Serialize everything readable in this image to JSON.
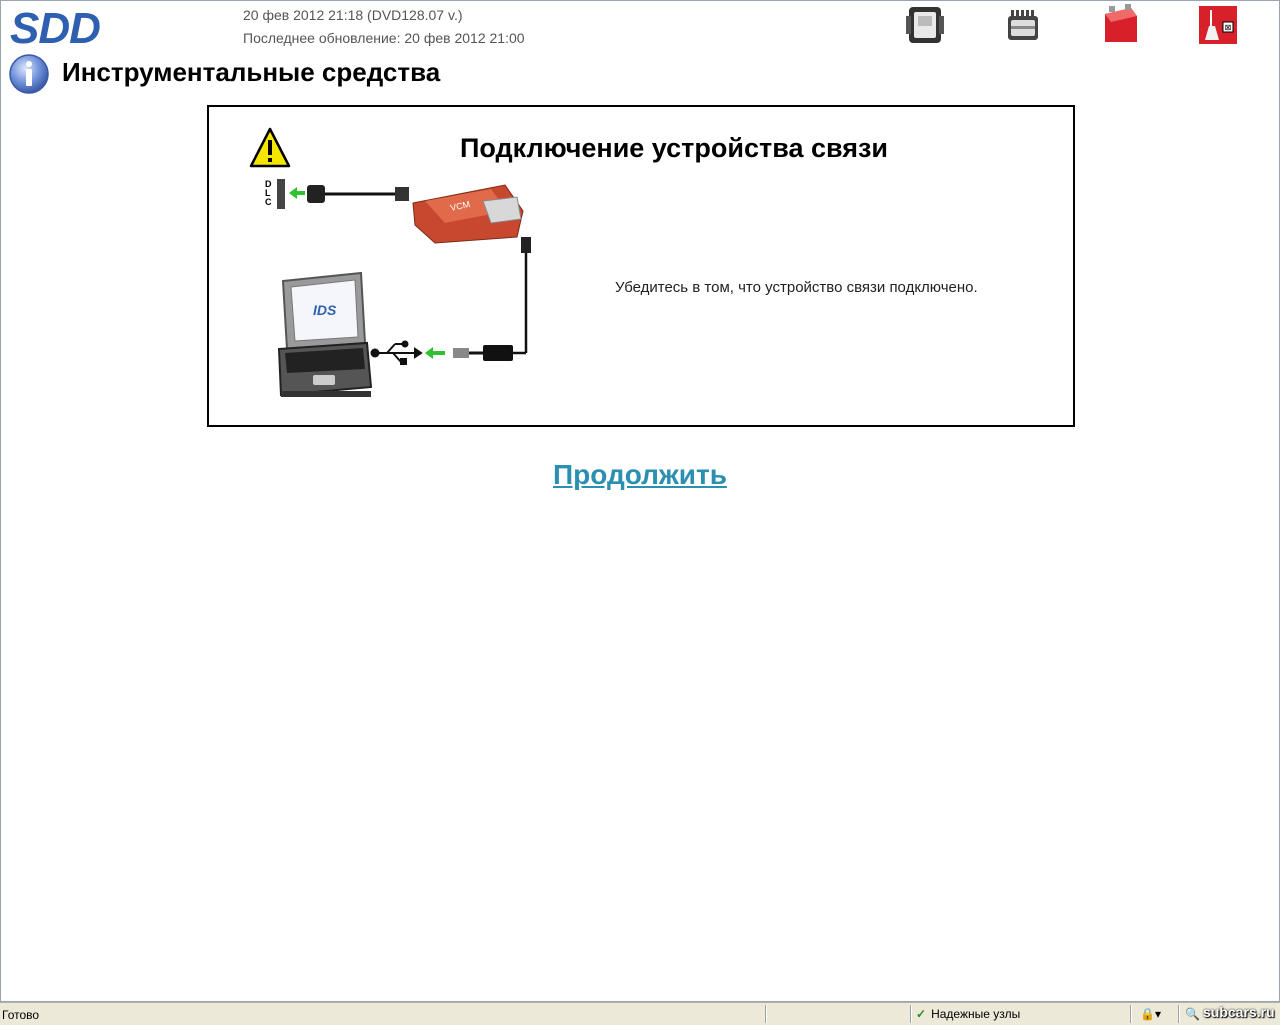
{
  "header": {
    "logo": "SDD",
    "session_line": "20 фев 2012 21:18 (DVD128.07 v.)",
    "update_line": "Последнее обновление: 20 фев 2012 21:00"
  },
  "toolbar": {
    "icons": [
      "vci-device-icon",
      "ecu-module-icon",
      "red-battery-icon",
      "red-tool-icon"
    ]
  },
  "page": {
    "title": "Инструментальные средства"
  },
  "connect_box": {
    "title": "Подключение устройства связи",
    "message": "Убедитесь в том, что устройство связи подключено.",
    "illustration": {
      "dlc_letters": [
        "D",
        "L",
        "C"
      ],
      "laptop_label": "IDS"
    }
  },
  "actions": {
    "continue_label": "Продолжить"
  },
  "statusbar": {
    "ready": "Готово",
    "zone": "Надежные узлы"
  },
  "watermark": "subcars.ru",
  "colors": {
    "logo_blue": "#2f5fb0",
    "link_teal": "#2a8fb0",
    "warning_yellow": "#f5e600",
    "toolbar_red": "#d8202a"
  }
}
